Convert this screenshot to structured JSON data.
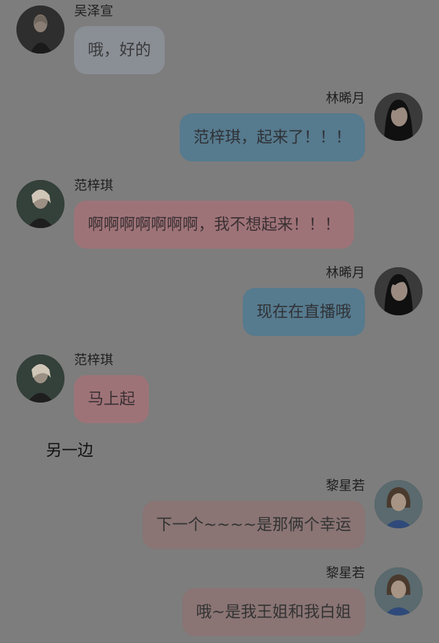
{
  "colors": {
    "background": "#7d7d7d",
    "bubble_gray": "#8a8e95",
    "bubble_blue": "#567a8e",
    "bubble_pink": "#9e7378",
    "bubble_mauve": "#8a7474"
  },
  "messages": [
    {
      "sender": "吴泽宣",
      "text": "哦，好的",
      "side": "left",
      "bubble_color": "gray"
    },
    {
      "sender": "林晞月",
      "text": "范梓琪，起来了！！！",
      "side": "right",
      "bubble_color": "blue"
    },
    {
      "sender": "范梓琪",
      "text": "啊啊啊啊啊啊啊，我不想起来！！！",
      "side": "left",
      "bubble_color": "pink"
    },
    {
      "sender": "林晞月",
      "text": "现在在直播哦",
      "side": "right",
      "bubble_color": "blue"
    },
    {
      "sender": "范梓琪",
      "text": "马上起",
      "side": "left",
      "bubble_color": "pink"
    },
    {
      "sender": "黎星若",
      "text": "下一个~~~~是那俩个幸运",
      "side": "right",
      "bubble_color": "mauve"
    },
    {
      "sender": "黎星若",
      "text": "哦~是我王姐和我白姐",
      "side": "right",
      "bubble_color": "mauve"
    }
  ],
  "section_label": "另一边"
}
